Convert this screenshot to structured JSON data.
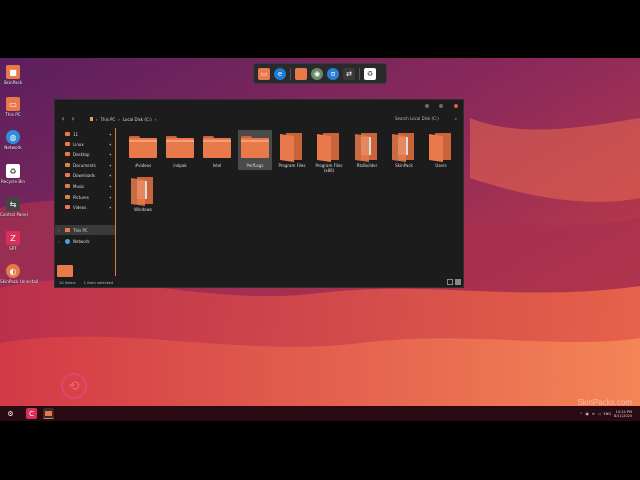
{
  "desktop_icons": [
    {
      "label": "SkinPack",
      "icon": "skinpack-app-icon",
      "color": "#e8794a"
    },
    {
      "label": "This PC",
      "icon": "computer-icon",
      "color": "#e8794a"
    },
    {
      "label": "Network",
      "icon": "network-globe-icon",
      "color": "#2d8ee0"
    },
    {
      "label": "Recycle Bin",
      "icon": "recycle-bin-icon",
      "color": "#ffffff"
    },
    {
      "label": "Control Panel",
      "icon": "control-panel-icon",
      "color": "#444444"
    },
    {
      "label": "SPT",
      "icon": "spt-app-icon",
      "color": "#d9305a"
    },
    {
      "label": "SkinPack Uninstall",
      "icon": "uninstall-icon",
      "color": "#e8794a"
    }
  ],
  "dock": {
    "items": [
      "monitor-icon",
      "browser-icon",
      "folder-icon",
      "record-icon",
      "shield-icon",
      "toggle-icon",
      "recycle-icon"
    ]
  },
  "explorer": {
    "breadcrumb": [
      "This PC",
      "Local Disk (C:)"
    ],
    "search_placeholder": "Search Local Disk (C:)",
    "nav_items": [
      {
        "label": "11",
        "pinned": true
      },
      {
        "label": "Linux",
        "pinned": true
      },
      {
        "label": "Desktop",
        "pinned": true
      },
      {
        "label": "Documents",
        "pinned": true
      },
      {
        "label": "Downloads",
        "pinned": true
      },
      {
        "label": "Music",
        "pinned": true
      },
      {
        "label": "Pictures",
        "pinned": true
      },
      {
        "label": "Videos",
        "pinned": true
      }
    ],
    "nav_this_pc": "This PC",
    "nav_network": "Network",
    "folders": [
      {
        "label": "#videos",
        "style": "closed",
        "selected": false
      },
      {
        "label": "indpak",
        "style": "closed",
        "selected": false
      },
      {
        "label": "Intel",
        "style": "closed",
        "selected": false
      },
      {
        "label": "PerfLogs",
        "style": "closed",
        "selected": true
      },
      {
        "label": "Program Files",
        "style": "open",
        "selected": false
      },
      {
        "label": "Program Files (x86)",
        "style": "open",
        "selected": false
      },
      {
        "label": "RtsBuilder",
        "style": "open-doc",
        "selected": false
      },
      {
        "label": "SkinPack",
        "style": "open-doc",
        "selected": false
      },
      {
        "label": "Users",
        "style": "open",
        "selected": false
      },
      {
        "label": "Windows",
        "style": "open-doc",
        "selected": false
      }
    ],
    "status_items": "10 items",
    "status_selected": "1 item selected"
  },
  "taskbar": {
    "tray_lang": "ENG",
    "time": "10:24 PM",
    "date": "8/11/2020"
  },
  "watermark": "SkinPacks.com"
}
